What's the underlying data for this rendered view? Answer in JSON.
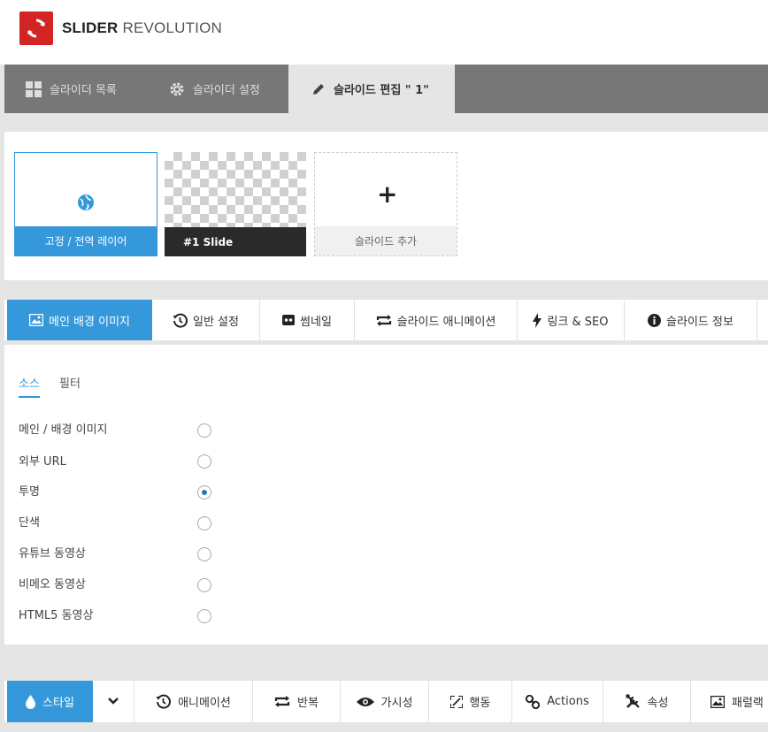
{
  "brand": {
    "bold": "SLIDER",
    "light": "REVOLUTION",
    "accent": "#d32424"
  },
  "nav": {
    "tabs": [
      {
        "label": "슬라이더 목록",
        "icon": "grid-icon"
      },
      {
        "label": "슬라이더 설정",
        "icon": "gear-icon"
      },
      {
        "label": "슬라이드 편집 \" 1\"",
        "icon": "pencil-icon"
      }
    ]
  },
  "slides": {
    "global_label": "고정 / 전역 레이어",
    "slide1_label": "#1 Slide",
    "add_label": "슬라이드 추가",
    "add_symbol": "+"
  },
  "tabs": [
    {
      "label": "메인 배경 이미지",
      "icon": "image-icon"
    },
    {
      "label": "일반 설정",
      "icon": "history-icon"
    },
    {
      "label": "썸네일",
      "icon": "thumbnail-icon"
    },
    {
      "label": "슬라이드 애니메이션",
      "icon": "loop-icon"
    },
    {
      "label": "링크 & SEO",
      "icon": "bolt-icon"
    },
    {
      "label": "슬라이드 정보",
      "icon": "info-icon"
    }
  ],
  "subtabs": {
    "source": "소스",
    "filter": "필터"
  },
  "options": [
    {
      "label": "메인 / 배경 이미지",
      "checked": false
    },
    {
      "label": "외부 URL",
      "checked": false
    },
    {
      "label": "투명",
      "checked": true
    },
    {
      "label": "단색",
      "checked": false
    },
    {
      "label": "유튜브 동영상",
      "checked": false
    },
    {
      "label": "비메오 동영상",
      "checked": false
    },
    {
      "label": "HTML5 동영상",
      "checked": false
    }
  ],
  "bottom_tabs": [
    {
      "label": "스타일",
      "icon": "drop-icon"
    },
    {
      "label": "",
      "icon": "chevron-down-icon"
    },
    {
      "label": "애니메이션",
      "icon": "history-icon"
    },
    {
      "label": "반복",
      "icon": "loop-icon"
    },
    {
      "label": "가시성",
      "icon": "eye-icon"
    },
    {
      "label": "행동",
      "icon": "expand-icon"
    },
    {
      "label": "Actions",
      "icon": "link-icon"
    },
    {
      "label": "속성",
      "icon": "tools-icon"
    },
    {
      "label": "패럴랙",
      "icon": "image-icon"
    }
  ],
  "colors": {
    "primary": "#3498db",
    "nav_bg": "#777777",
    "dark_slide": "#2a2a2a"
  }
}
